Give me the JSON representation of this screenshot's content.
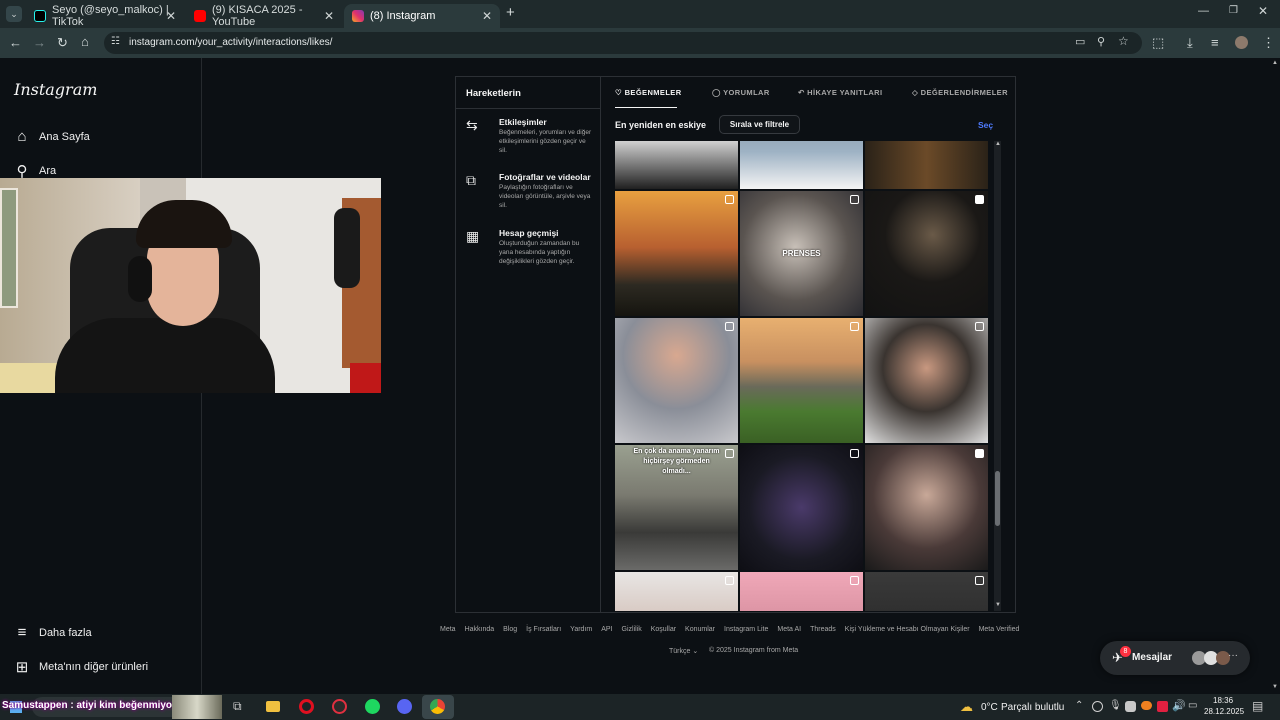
{
  "browser": {
    "tabs": [
      {
        "label": "Seyo (@seyo_malkoc) | TikTok",
        "active": false
      },
      {
        "label": "(9) KISACA 2025 - YouTube",
        "active": false
      },
      {
        "label": "(8) Instagram",
        "active": true
      }
    ],
    "new_tab": "+",
    "url": "instagram.com/your_activity/interactions/likes/"
  },
  "nav": {
    "logo": "Instagram",
    "home": "Ana Sayfa",
    "search": "Ara",
    "more": "Daha fazla",
    "meta_products": "Meta'nın diğer ürünleri"
  },
  "activity": {
    "title": "Hareketlerin",
    "items": [
      {
        "title": "Etkileşimler",
        "desc": "Beğenmeleri, yorumları ve diğer etkileşimlerini gözden geçir ve sil.",
        "icon": "arrows-icon"
      },
      {
        "title": "Fotoğraflar ve videolar",
        "desc": "Paylaştığın fotoğrafları ve videoları görüntüle, arşivle veya sil.",
        "icon": "media-icon"
      },
      {
        "title": "Hesap geçmişi",
        "desc": "Oluşturduğun zamandan bu yana hesabında yaptığın değişiklikleri gözden geçir.",
        "icon": "calendar-icon"
      }
    ]
  },
  "tabs": {
    "likes": "BEĞENMELER",
    "comments": "YORUMLAR",
    "story_replies": "HİKAYE YANITLARI",
    "reviews": "DEĞERLENDİRMELER"
  },
  "filters": {
    "sort": "En yeniden en eskiye",
    "sort_filter": "Sırala ve filtrele",
    "select": "Seç"
  },
  "grid": {
    "overlay_prenses": "PRENSES",
    "overlay_caption_line1": "En çok da anama yanarım",
    "overlay_caption_line2": "hiçbirşey görmeden",
    "overlay_caption_line3": "olmadı..."
  },
  "footer": {
    "links": [
      "Meta",
      "Hakkında",
      "Blog",
      "İş Fırsatları",
      "Yardım",
      "API",
      "Gizlilik",
      "Koşullar",
      "Konumlar",
      "Instagram Lite",
      "Meta AI",
      "Threads",
      "Kişi Yükleme ve Hesabı Olmayan Kişiler",
      "Meta Verified"
    ],
    "language": "Türkçe",
    "copyright": "© 2025 Instagram from Meta"
  },
  "messages": {
    "label": "Mesajlar",
    "badge": "8"
  },
  "taskbar": {
    "ticker": "Samustappen : atiyi kim beğenmiyo",
    "weather_temp": "0°C",
    "weather_desc": "Parçalı bulutlu",
    "time": "18:36",
    "date": "28.12.2025"
  },
  "colors": {
    "accent_blue": "#0095f6",
    "badge_red": "#ff3040",
    "background": "#0c1014"
  }
}
